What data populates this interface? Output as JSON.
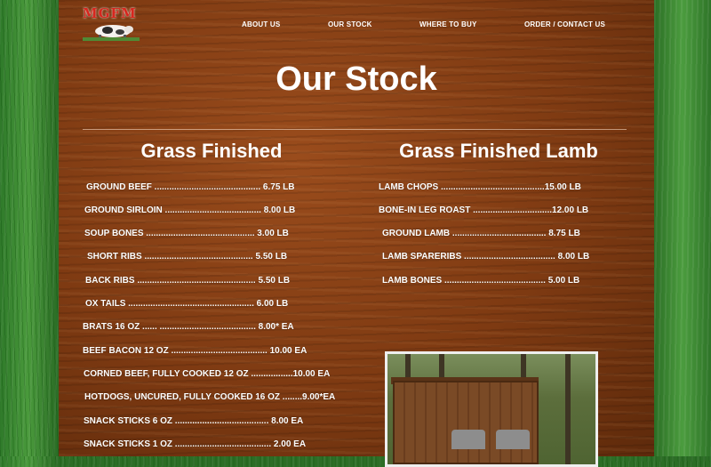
{
  "logo": {
    "text": "MGFM"
  },
  "nav": {
    "items": [
      {
        "label": "ABOUT US"
      },
      {
        "label": "OUR STOCK"
      },
      {
        "label": "WHERE TO BUY"
      },
      {
        "label": "ORDER / CONTACT US"
      }
    ]
  },
  "page": {
    "title": "Our Stock"
  },
  "beef": {
    "title": "Grass Finished",
    "items": [
      "GROUND BEEF ........................................... 6.75 LB",
      "GROUND SIRLOIN ....................................... 8.00 LB",
      "SOUP BONES ............................................ 3.00 LB",
      "SHORT RIBS ............................................ 5.50 LB",
      "BACK RIBS ................................................ 5.50 LB",
      "OX TAILS ................................................... 6.00 LB",
      "BRATS 16 OZ ...... ....................................... 8.00* EA",
      "BEEF BACON 12 OZ ....................................... 10.00 EA",
      "CORNED BEEF, FULLY COOKED 12 OZ .................10.00 EA",
      "HOTDOGS, UNCURED, FULLY COOKED 16 OZ ........9.00*EA",
      "SNACK STICKS 6 OZ ...................................... 8.00 EA",
      "SNACK STICKS 1 OZ ....................................... 2.00 EA"
    ]
  },
  "lamb": {
    "title": "Grass Finished Lamb",
    "items": [
      "LAMB CHOPS ..........................................15.00 LB",
      "BONE-IN LEG ROAST ................................12.00 LB",
      "GROUND LAMB ...................................... 8.75 LB",
      "LAMB SPARERIBS ..................................... 8.00 LB",
      "LAMB BONES ......................................... 5.00 LB"
    ]
  }
}
